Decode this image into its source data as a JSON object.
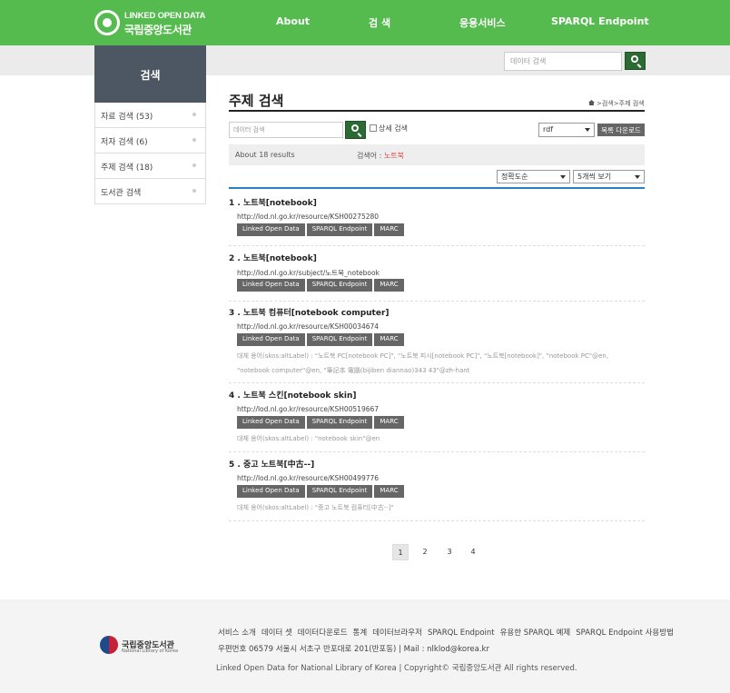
{
  "header": {
    "logo_line1": "LINKED OPEN DATA",
    "logo_line2": "국립중앙도서관",
    "nav": [
      "About",
      "검 색",
      "응용서비스",
      "SPARQL Endpoint"
    ]
  },
  "top_search": {
    "placeholder": "데이터 검색"
  },
  "sidebar": {
    "title": "검색",
    "items": [
      "자료 검색 (53)",
      "저자 검색 (6)",
      "주제 검색 (18)",
      "도서관 검색"
    ]
  },
  "main": {
    "title": "주제 검색",
    "breadcrumb": [
      "검색",
      "주제 검색"
    ],
    "search_placeholder": "데이터 검색",
    "advanced_label": "상세 검색",
    "format_select": "rdf",
    "download_label": "목록 다운로드",
    "result_count": "About 18 results",
    "search_term_label": "검색어 :",
    "search_term": "노트북",
    "sort_select": "정확도순",
    "per_page_select": "5개씩 보기",
    "tag_labels": [
      "Linked Open Data",
      "SPARQL Endpoint",
      "MARC"
    ],
    "results": [
      {
        "title": "1 . 노트북[notebook]",
        "url": "http://lod.nl.go.kr/resource/KSH00275280",
        "alt": []
      },
      {
        "title": "2 . 노트북[notebook]",
        "url": "http://lod.nl.go.kr/subject/노트북_notebook",
        "alt": []
      },
      {
        "title": "3 . 노트북 컴퓨터[notebook computer]",
        "url": "http://lod.nl.go.kr/resource/KSH00034674",
        "alt": [
          "대체 용어(skos:altLabel) : \"노트북 PC[notebook PC]\", \"노트북 피시[notebook PC]\", \"노트북[notebook]\", \"notebook PC\"@en,",
          "\"notebook computer\"@en, \"筆記本 電腦(bijiben diannao)343 43\"@zh-hant"
        ]
      },
      {
        "title": "4 . 노트북 스킨[notebook skin]",
        "url": "http://lod.nl.go.kr/resource/KSH00519667",
        "alt": [
          "대체 용어(skos:altLabel) : \"notebook skin\"@en"
        ]
      },
      {
        "title": "5 . 중고 노트북[中古--]",
        "url": "http://lod.nl.go.kr/resource/KSH00499776",
        "alt": [
          "대체 용어(skos:altLabel) : \"중고 노트북 컴퓨터[中古--]\""
        ]
      }
    ],
    "pages": [
      "1",
      "2",
      "3",
      "4"
    ]
  },
  "footer": {
    "logo_title": "국립중앙도서관",
    "logo_sub": "National Library of Korea",
    "links": [
      "서비스 소개",
      "데이터 셋",
      "데이터다운로드",
      "통계",
      "데이터브라우저",
      "SPARQL Endpoint",
      "유용한 SPARQL 예제",
      "SPARQL Endpoint 사용방법"
    ],
    "address": "우편번호 06579 서울시 서초구 반포대로 201(반포동) | Mail : nlklod@korea.kr",
    "copyright": "Linked Open Data for National Library of Korea | Copyright© 국립중앙도서관 All rights reserved."
  },
  "colors": {
    "green": "#55bb4e",
    "dark_green": "#2c6a34",
    "sidebar_title": "#4c5763",
    "highlight_red": "#e0403a",
    "blue_rule": "#2a7fc3"
  }
}
